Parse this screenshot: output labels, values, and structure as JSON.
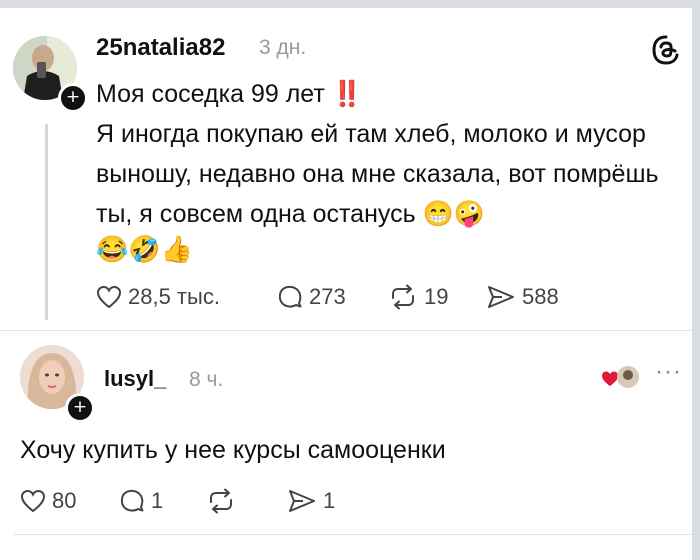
{
  "post": {
    "username": "25natalia82",
    "time": "3 дн.",
    "title_line": "Моя соседка 99 лет",
    "title_marks": "‼️",
    "body": "Я иногда покупаю ей там хлеб, молоко и мусор выношу, недавно она мне сказала, вот помрёшь ты, я совсем одна останусь",
    "inline_emojis": "😁🤪",
    "tail_emojis": "😂🤣👍",
    "likes": "28,5 тыс.",
    "comments": "273",
    "reposts": "19",
    "shares": "588"
  },
  "reply": {
    "username": "lusyl_",
    "time": "8 ч.",
    "text": "Хочу купить у нее курсы самооценки",
    "likes": "80",
    "comments": "1",
    "reposts": "",
    "shares": "1",
    "more": "···"
  },
  "icons": {
    "app_logo": "threads-logo-icon",
    "like": "heart-icon",
    "comment": "speech-bubble-icon",
    "repost": "repost-icon",
    "share": "send-icon",
    "follow": "plus-icon",
    "reaction": "heart-icon"
  },
  "colors": {
    "text": "#111111",
    "muted": "#9a9a9a",
    "accent_red": "#e0193a"
  }
}
